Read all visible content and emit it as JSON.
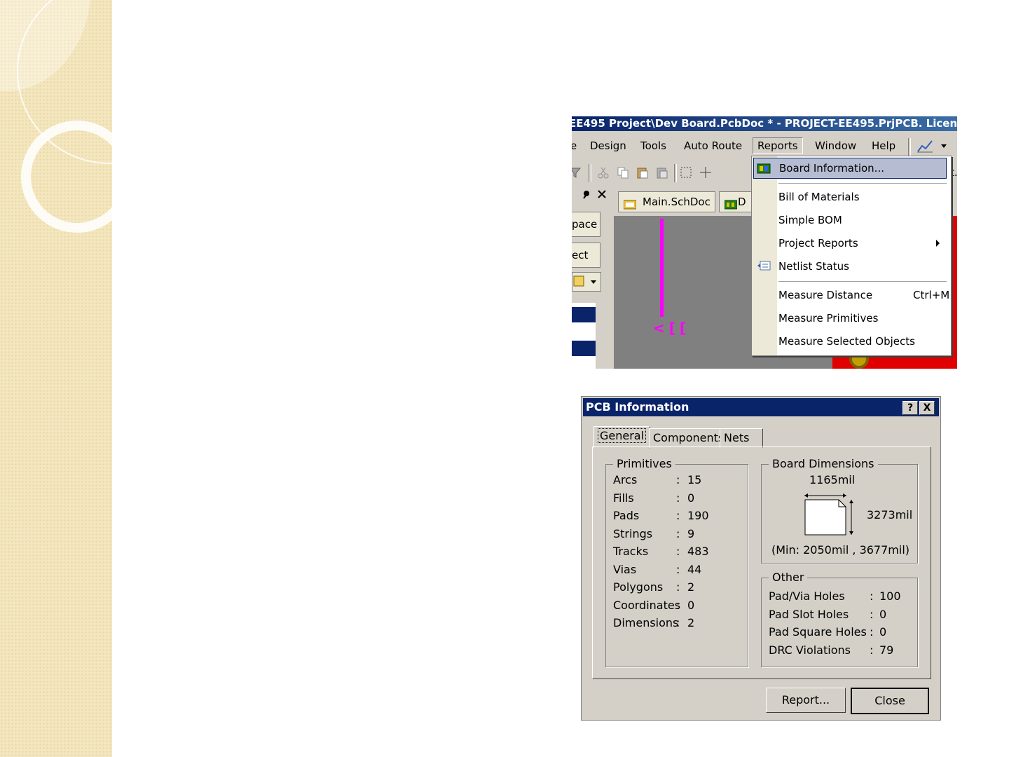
{
  "app_window": {
    "title": "EE495 Project\\Dev Board.PcbDoc * - PROJECT-EE495.PrjPCB. Licen",
    "menu": [
      "e",
      "Design",
      "Tools",
      "Auto Route",
      "Reports",
      "Window",
      "Help"
    ],
    "active_menu": "Reports",
    "doc_tabs": [
      "Main.SchDoc",
      "D"
    ],
    "left_panel_buttons": [
      "pace",
      "ect"
    ],
    "toolbar_overflow_text": "t.",
    "canvas_text": "<[[",
    "reports_menu": {
      "items": [
        {
          "label": "Board Information...",
          "highlighted": true
        },
        {
          "label": "Bill of Materials"
        },
        {
          "label": "Simple BOM"
        },
        {
          "label": "Project Reports",
          "submenu": true
        },
        {
          "label": "Netlist Status"
        },
        {
          "label": "Measure Distance",
          "shortcut": "Ctrl+M"
        },
        {
          "label": "Measure Primitives"
        },
        {
          "label": "Measure Selected Objects"
        }
      ]
    }
  },
  "pcb_dialog": {
    "title": "PCB Information",
    "help_button": "?",
    "close_x": "X",
    "tabs": [
      "General",
      "Components",
      "Nets"
    ],
    "selected_tab": "General",
    "primitives": {
      "label": "Primitives",
      "rows": [
        {
          "name": "Arcs",
          "value": "15"
        },
        {
          "name": "Fills",
          "value": "0"
        },
        {
          "name": "Pads",
          "value": "190"
        },
        {
          "name": "Strings",
          "value": "9"
        },
        {
          "name": "Tracks",
          "value": "483"
        },
        {
          "name": "Vias",
          "value": "44"
        },
        {
          "name": "Polygons",
          "value": "2"
        },
        {
          "name": "Coordinates",
          "value": "0"
        },
        {
          "name": "Dimensions",
          "value": "2"
        }
      ]
    },
    "board_dimensions": {
      "label": "Board Dimensions",
      "width": "1165mil",
      "height": "3273mil",
      "min": "(Min: 2050mil , 3677mil)"
    },
    "other": {
      "label": "Other",
      "rows": [
        {
          "name": "Pad/Via Holes",
          "value": "100"
        },
        {
          "name": "Pad Slot Holes",
          "value": "0"
        },
        {
          "name": "Pad Square Holes",
          "value": "0"
        },
        {
          "name": "DRC Violations",
          "value": "79"
        }
      ]
    },
    "colon": ":",
    "buttons": {
      "report": "Report...",
      "close": "Close"
    }
  },
  "colors": {
    "title_blue": "#0a246a",
    "dialog_gray": "#d4d0c8",
    "menu_highlight": "#b6bdd2",
    "trace_magenta": "#ff00ff",
    "pcb_red": "#e00000",
    "deco_beige": "#f4e7bf"
  }
}
